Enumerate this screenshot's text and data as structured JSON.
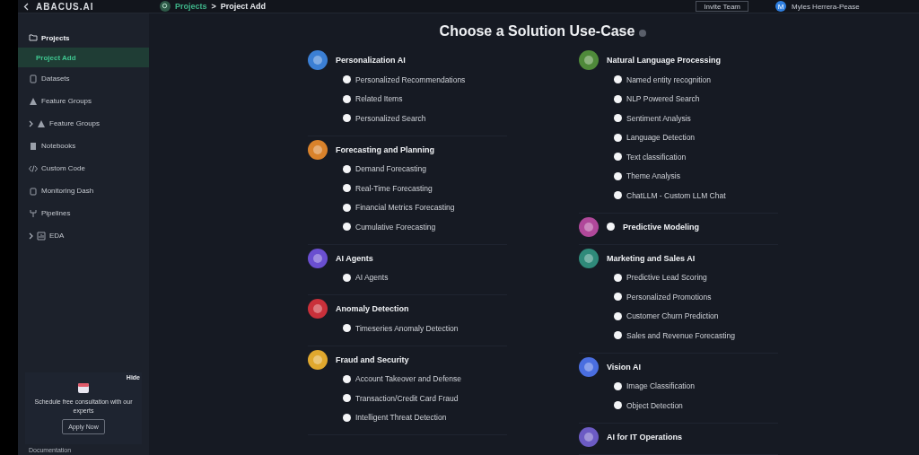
{
  "topbar": {
    "logo": "ABACUS.AI",
    "breadcrumbs": [
      "Projects",
      "Project Add"
    ],
    "separator": ">",
    "invite_button": "Invite Team",
    "avatar": "M",
    "user": "Myles Herrera-Pease"
  },
  "sidebar": {
    "items": [
      {
        "label": "Projects",
        "selected": false,
        "children": [
          {
            "label": "Project Add",
            "selected": true
          }
        ]
      },
      {
        "label": "Datasets",
        "selected": false
      },
      {
        "label": "Feature Groups",
        "selected": false
      },
      {
        "label": "Feature Groups",
        "selected": false,
        "expanded": false
      },
      {
        "label": "Notebooks",
        "selected": false
      },
      {
        "label": "Custom Code",
        "selected": false
      },
      {
        "label": "Monitoring Dash",
        "selected": false
      },
      {
        "label": "Pipelines",
        "selected": false
      },
      {
        "label": "EDA",
        "selected": false,
        "expanded": false
      }
    ],
    "promo": {
      "hide": "Hide",
      "text": "Schedule free consultation with our experts",
      "button": "Apply Now"
    },
    "footer_link": "Documentation"
  },
  "main": {
    "title": "Choose a Solution Use-Case",
    "columns": [
      [
        {
          "kind": "group",
          "title": "Personalization AI",
          "color": "#3b7fd4",
          "items": [
            {
              "label": "Personalized Recommendations",
              "selected": false
            },
            {
              "label": "Related Items",
              "selected": false
            },
            {
              "label": "Personalized Search",
              "selected": false
            }
          ]
        },
        {
          "kind": "group",
          "title": "Forecasting and Planning",
          "color": "#d9822b",
          "items": [
            {
              "label": "Demand Forecasting",
              "selected": false
            },
            {
              "label": "Real-Time Forecasting",
              "selected": false
            },
            {
              "label": "Financial Metrics Forecasting",
              "selected": false
            },
            {
              "label": "Cumulative Forecasting",
              "selected": false
            }
          ]
        },
        {
          "kind": "group",
          "title": "AI Agents",
          "color": "#6a4fd0",
          "items": [
            {
              "label": "AI Agents",
              "selected": false
            }
          ]
        },
        {
          "kind": "group",
          "title": "Anomaly Detection",
          "color": "#c9303a",
          "items": [
            {
              "label": "Timeseries Anomaly Detection",
              "selected": false
            }
          ]
        },
        {
          "kind": "group",
          "title": "Fraud and Security",
          "color": "#e0a82e",
          "items": [
            {
              "label": "Account Takeover and Defense",
              "selected": false
            },
            {
              "label": "Transaction/Credit Card Fraud",
              "selected": false
            },
            {
              "label": "Intelligent Threat Detection",
              "selected": false
            }
          ]
        }
      ],
      [
        {
          "kind": "group",
          "title": "Natural Language Processing",
          "color": "#4f8a3a",
          "items": [
            {
              "label": "Named entity recognition",
              "selected": false
            },
            {
              "label": "NLP Powered Search",
              "selected": false
            },
            {
              "label": "Sentiment Analysis",
              "selected": false
            },
            {
              "label": "Language Detection",
              "selected": false
            },
            {
              "label": "Text classification",
              "selected": false
            },
            {
              "label": "Theme Analysis",
              "selected": false
            },
            {
              "label": "ChatLLM - Custom LLM Chat",
              "selected": false
            }
          ]
        },
        {
          "kind": "single",
          "title": "Predictive Modeling",
          "color": "#b0489a",
          "selected": false
        },
        {
          "kind": "group",
          "title": "Marketing and Sales AI",
          "color": "#2f8a7a",
          "items": [
            {
              "label": "Predictive Lead Scoring",
              "selected": false
            },
            {
              "label": "Personalized Promotions",
              "selected": false
            },
            {
              "label": "Customer Churn Prediction",
              "selected": false
            },
            {
              "label": "Sales and Revenue Forecasting",
              "selected": false
            }
          ]
        },
        {
          "kind": "group",
          "title": "Vision AI",
          "color": "#4a6ee0",
          "items": [
            {
              "label": "Image Classification",
              "selected": false
            },
            {
              "label": "Object Detection",
              "selected": false
            }
          ]
        },
        {
          "kind": "group",
          "title": "AI for IT Operations",
          "color": "#6c5bc4"
        }
      ]
    ]
  }
}
